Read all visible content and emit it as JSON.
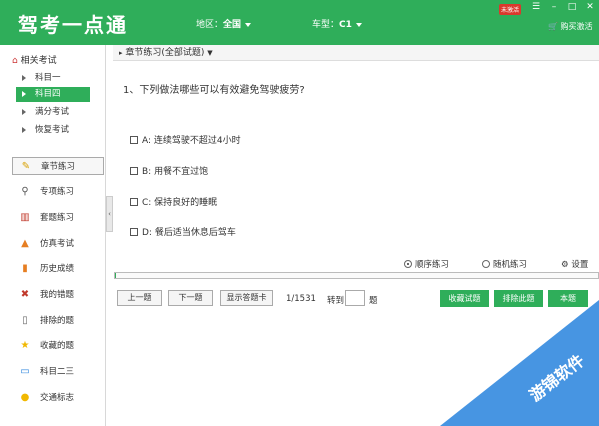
{
  "header": {
    "app_title": "驾考一点通",
    "region_label": "地区：",
    "region_value": "全国",
    "cartype_label": "车型：",
    "cartype_value": "C1",
    "unactivated_badge": "未激活",
    "buy_label": "购买激活"
  },
  "sidebar": {
    "tree_title": "相关考试",
    "tree_items": [
      {
        "label": "科目一",
        "active": false
      },
      {
        "label": "科目四",
        "active": true
      },
      {
        "label": "满分考试",
        "active": false
      },
      {
        "label": "恢复考试",
        "active": false
      }
    ],
    "nav_items": [
      {
        "label": "章节练习",
        "icon": "pencil-icon",
        "active": true
      },
      {
        "label": "专项练习",
        "icon": "search-icon"
      },
      {
        "label": "套题练习",
        "icon": "books-icon"
      },
      {
        "label": "仿真考试",
        "icon": "cap-icon"
      },
      {
        "label": "历史成绩",
        "icon": "bar-chart-icon"
      },
      {
        "label": "我的错题",
        "icon": "cross-icon"
      },
      {
        "label": "排除的题",
        "icon": "trash-icon"
      },
      {
        "label": "收藏的题",
        "icon": "star-icon"
      },
      {
        "label": "科目二三",
        "icon": "phone-icon"
      },
      {
        "label": "交通标志",
        "icon": "warning-icon"
      }
    ]
  },
  "main": {
    "breadcrumb": "章节练习(全部试题)",
    "question": "1、下列做法哪些可以有效避免驾驶疲劳?",
    "options": [
      "A: 连续驾驶不超过4小时",
      "B: 用餐不宜过饱",
      "C: 保持良好的睡眠",
      "D: 餐后适当休息后驾车"
    ],
    "mode_sequential": "顺序练习",
    "mode_random": "随机练习",
    "settings_label": "设置",
    "progress_fraction": 0.0007,
    "prev_label": "上一题",
    "next_label": "下一题",
    "answer_card_label": "显示答题卡",
    "counter": "1/1531",
    "goto_label": "转到",
    "goto_suffix": "题",
    "favorite_label": "收藏试题",
    "exclude_label": "排除此题",
    "more_label": "本题"
  },
  "watermark_text": "游锦软件",
  "colors": {
    "brand_green": "#2fae5a",
    "watermark_blue": "#3d8fe0"
  }
}
